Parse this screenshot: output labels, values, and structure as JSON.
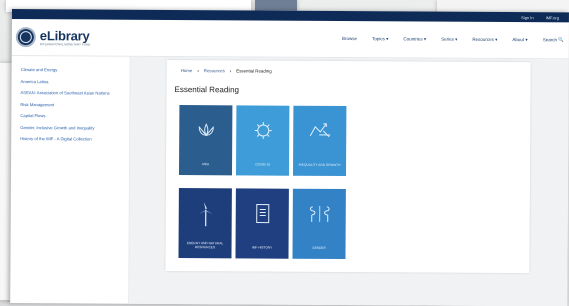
{
  "topbar": {
    "sign_in": "Sign In",
    "imf_site": "IMF.org"
  },
  "brand": {
    "name": "eLibrary",
    "subtitle": "INTERNATIONAL MONETARY FUND"
  },
  "nav": [
    {
      "label": "Browse"
    },
    {
      "label": "Topics ▾"
    },
    {
      "label": "Countries ▾"
    },
    {
      "label": "Series ▾"
    },
    {
      "label": "Resources ▾"
    },
    {
      "label": "About ▾"
    },
    {
      "label": "Search 🔍"
    }
  ],
  "sidebar": {
    "items": [
      {
        "label": "Climate and Energy"
      },
      {
        "label": "America Latina"
      },
      {
        "label": "ASEAN: Association of Southeast Asian Nations"
      },
      {
        "label": "Risk Management"
      },
      {
        "label": "Capital Flows"
      },
      {
        "label": "Gender, Inclusive Growth and Inequality"
      },
      {
        "label": "History of the IMF - A Digital Collection"
      }
    ]
  },
  "breadcrumb": {
    "home": "Home",
    "sep": "›",
    "resources": "Resources",
    "current": "Essential Reading"
  },
  "page_title": "Essential Reading",
  "tiles": [
    {
      "label": "ASIA",
      "icon": "lotus-icon",
      "color": "#2b5e8f"
    },
    {
      "label": "COVID-19",
      "icon": "virus-icon",
      "color": "#3e9dd9"
    },
    {
      "label": "INEQUALITY AND GROWTH",
      "icon": "growth-chart-icon",
      "color": "#3a93d3"
    },
    {
      "label": "ENERGY AND NATURAL RESOURCES",
      "icon": "wind-turbine-icon",
      "color": "#1e3e7b"
    },
    {
      "label": "IMF HISTORY",
      "icon": "book-icon",
      "color": "#1f3f80"
    },
    {
      "label": "GENDER",
      "icon": "gender-icon",
      "color": "#3382c6"
    }
  ]
}
